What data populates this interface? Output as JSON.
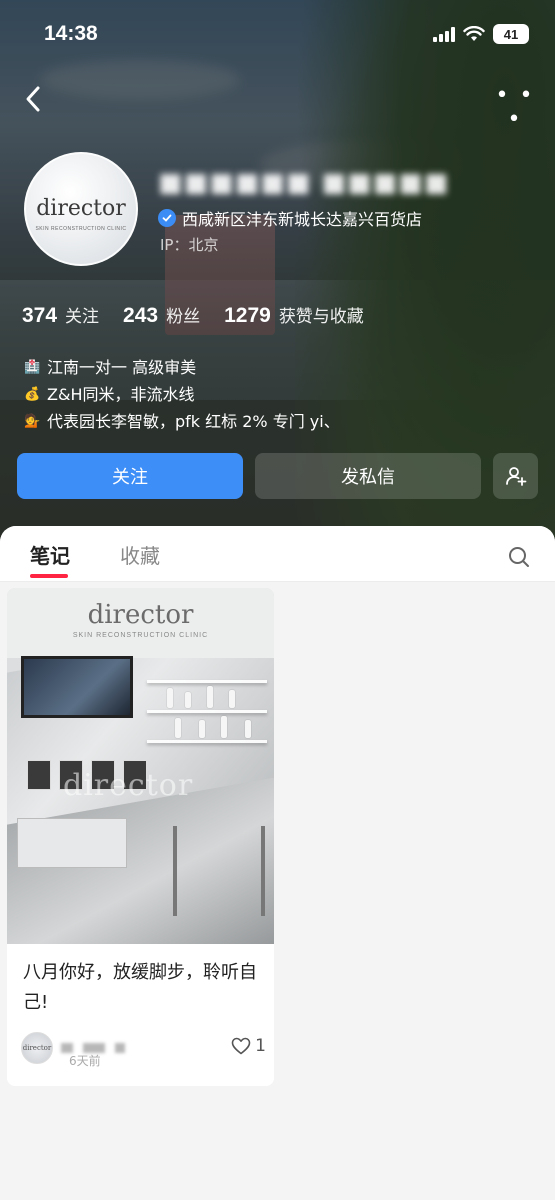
{
  "status_bar": {
    "time": "14:38",
    "battery": "41"
  },
  "profile": {
    "avatar_logo": "director",
    "avatar_subtitle": "SKIN RECONSTRUCTION CLINIC",
    "verified_text": "西咸新区沣东新城长达嘉兴百货店",
    "ip_label": "IP：北京"
  },
  "stats": [
    {
      "value": "374",
      "label": "关注"
    },
    {
      "value": "243",
      "label": "粉丝"
    },
    {
      "value": "1279",
      "label": "获赞与收藏"
    }
  ],
  "bio": [
    {
      "icon": "hospital-emoji-icon",
      "emoji": "🏥",
      "text": "江南一对一 高级审美"
    },
    {
      "icon": "money-bag-emoji-icon",
      "emoji": "💰",
      "text": "Z&H同米，非流水线"
    },
    {
      "icon": "person-emoji-icon",
      "emoji": "💁",
      "text": "代表园长李智敏，pfk 红标 2% 专门 yi、"
    }
  ],
  "actions": {
    "follow": "关注",
    "message": "发私信"
  },
  "tabs": {
    "notes": "笔记",
    "favorites": "收藏"
  },
  "note": {
    "cover_logo": "director",
    "cover_subtitle": "SKIN RECONSTRUCTION CLINIC",
    "cover_watermark": "director",
    "title": "八月你好，放缓脚步，聆听自己!",
    "avatar_text": "director",
    "time": "6天前",
    "likes": "1"
  },
  "colors": {
    "accent": "#3e8ef7",
    "tab_indicator": "#ff2442",
    "verify_badge": "#3c8cf5"
  }
}
